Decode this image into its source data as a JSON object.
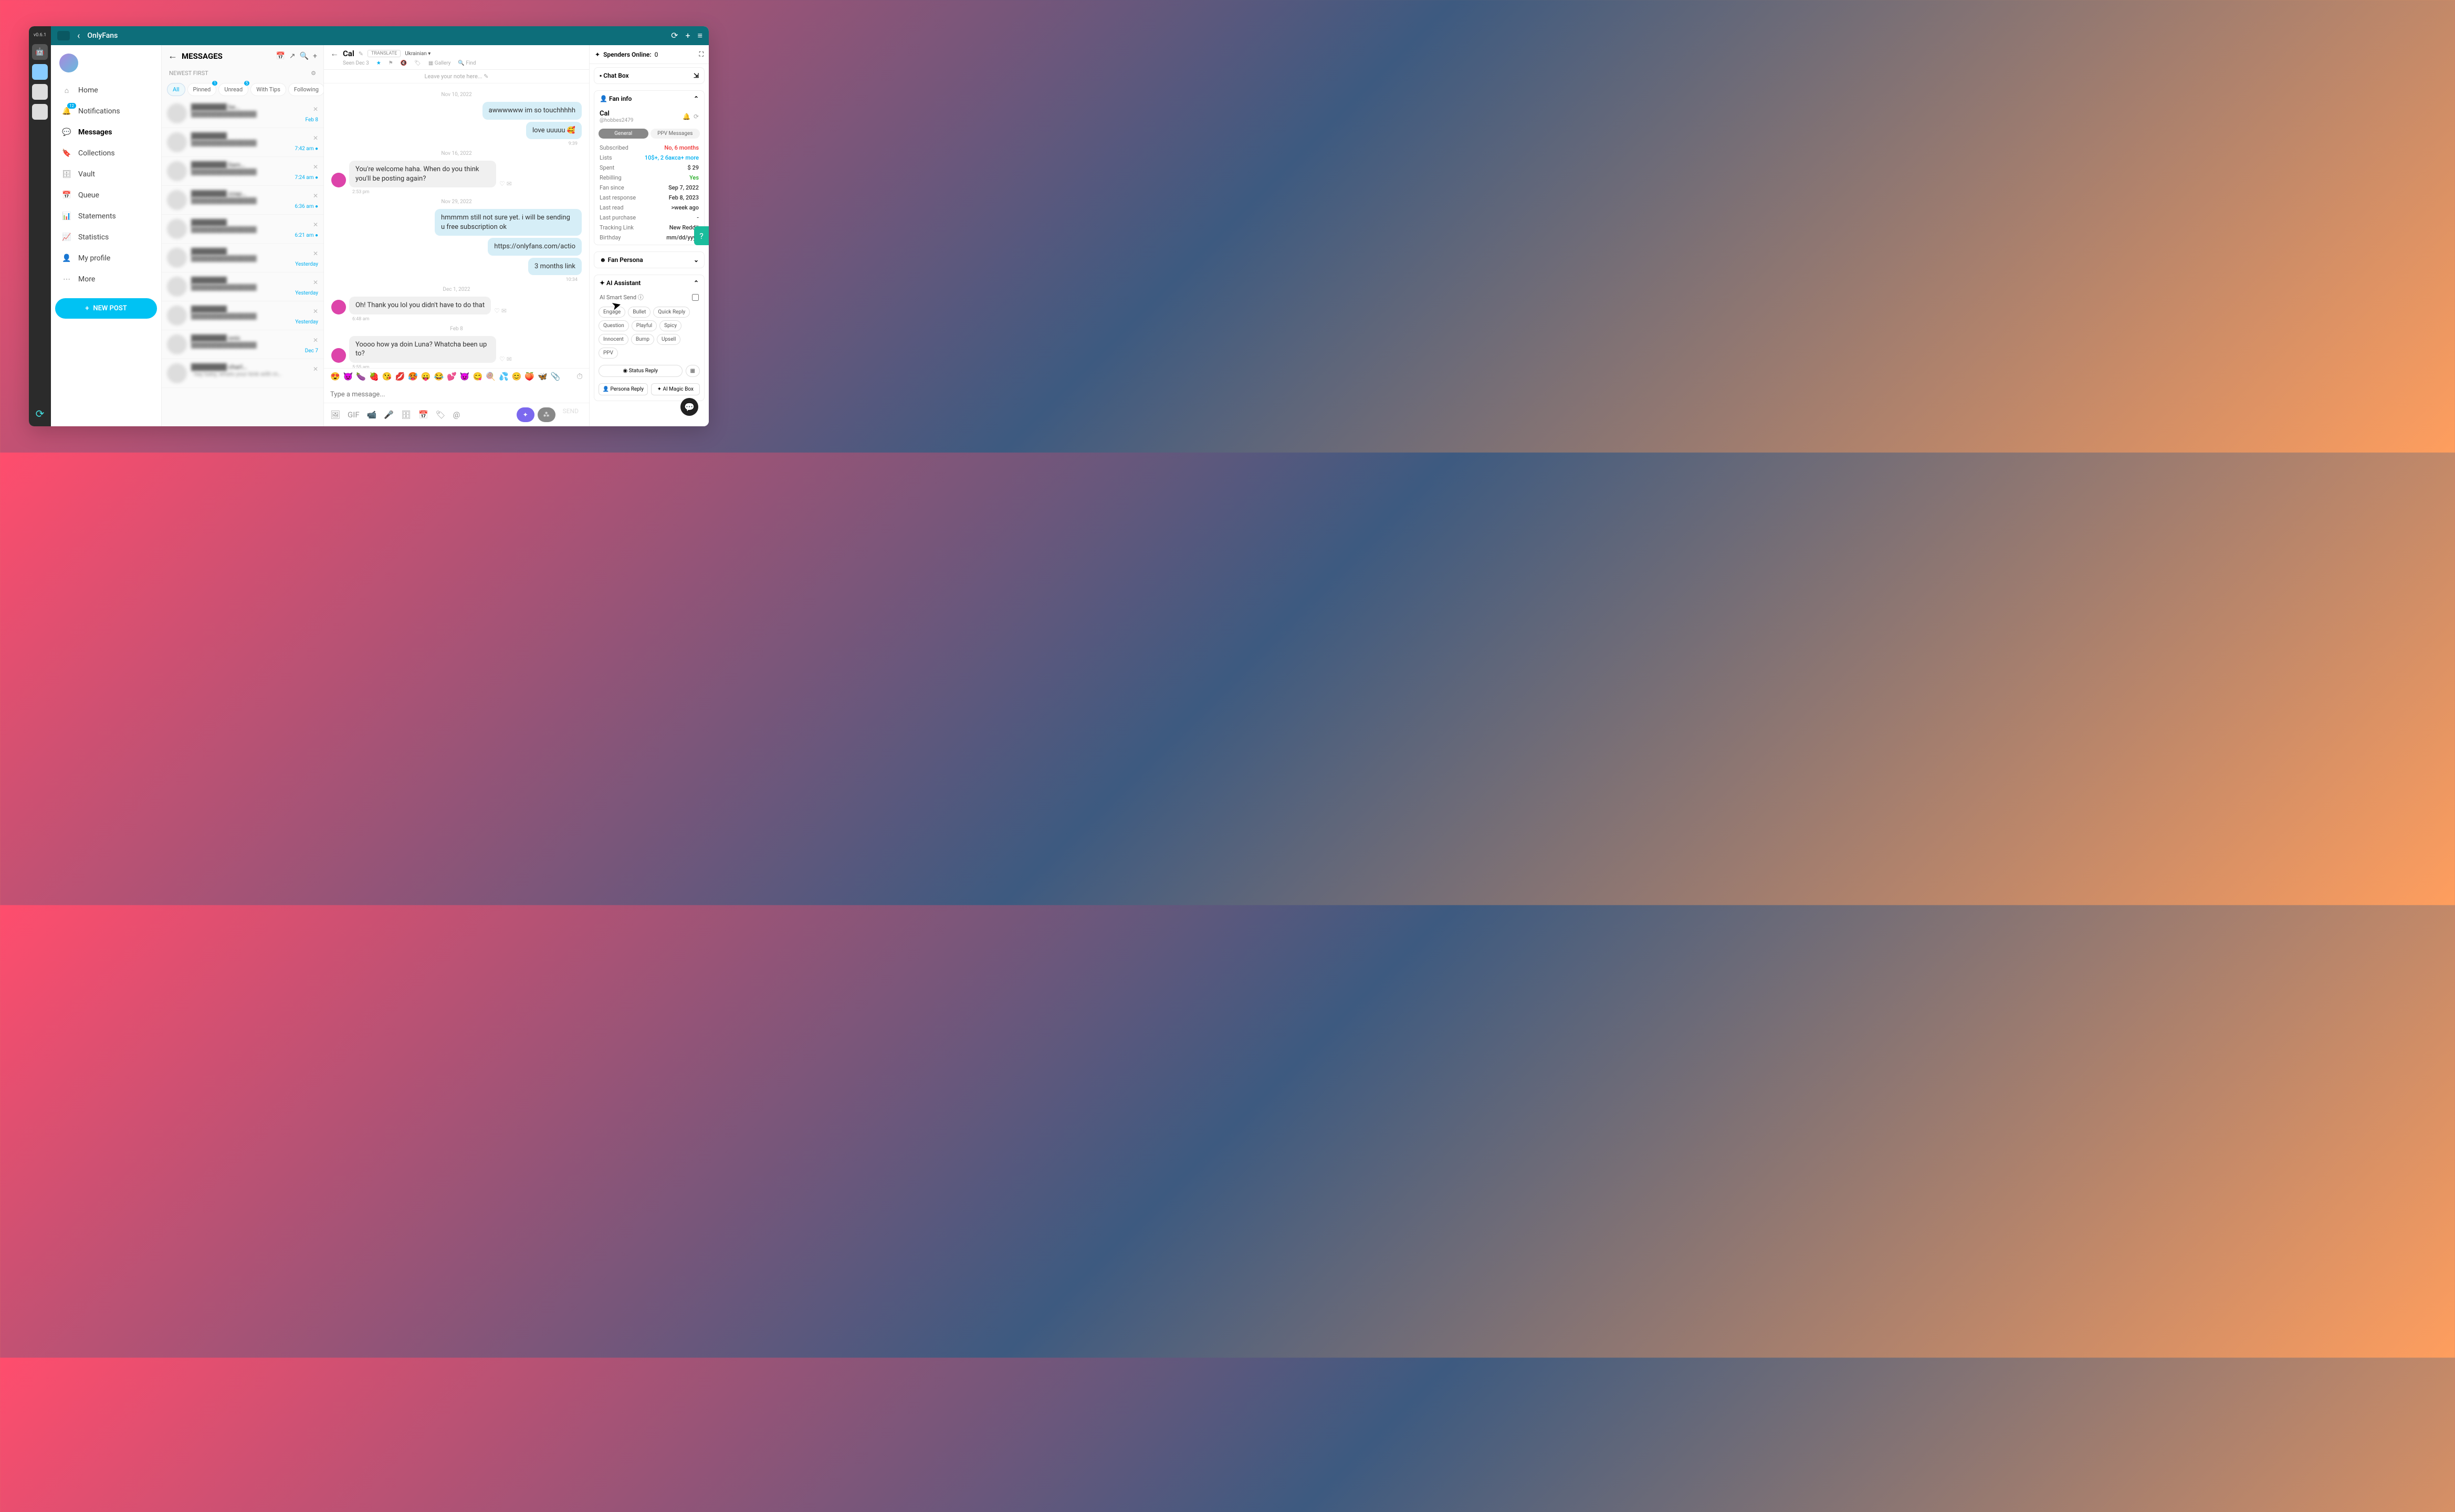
{
  "version": "v0.6.1",
  "titlebar": {
    "title": "OnlyFans"
  },
  "sidebar": {
    "items": [
      {
        "label": "Home",
        "icon": "home-icon"
      },
      {
        "label": "Notifications",
        "icon": "bell-icon",
        "badge": "12"
      },
      {
        "label": "Messages",
        "icon": "chat-icon",
        "active": true
      },
      {
        "label": "Collections",
        "icon": "bookmark-icon"
      },
      {
        "label": "Vault",
        "icon": "archive-icon"
      },
      {
        "label": "Queue",
        "icon": "calendar-icon"
      },
      {
        "label": "Statements",
        "icon": "chart-icon"
      },
      {
        "label": "Statistics",
        "icon": "stats-icon"
      },
      {
        "label": "My profile",
        "icon": "person-icon"
      },
      {
        "label": "More",
        "icon": "more-icon"
      }
    ],
    "new_post": "NEW POST"
  },
  "msg_list": {
    "title": "MESSAGES",
    "sort": "NEWEST FIRST",
    "filters": [
      {
        "label": "All",
        "active": true
      },
      {
        "label": "Pinned",
        "badge": "1"
      },
      {
        "label": "Unread",
        "badge": "5"
      },
      {
        "label": "With Tips"
      },
      {
        "label": "Following"
      }
    ],
    "conversations": [
      {
        "suffix": "be…",
        "time": "Feb 8"
      },
      {
        "suffix": "",
        "time": "7:42 am",
        "unread": true
      },
      {
        "suffix": "liam…",
        "time": "7:24 am",
        "unread": true
      },
      {
        "suffix": "zzap…",
        "time": "6:36 am",
        "unread": true
      },
      {
        "suffix": "",
        "time": "6:21 am",
        "unread": true
      },
      {
        "suffix": "",
        "time": "Yesterday"
      },
      {
        "suffix": "",
        "time": "Yesterday"
      },
      {
        "suffix": "",
        "time": "Yesterday"
      },
      {
        "suffix": "onic",
        "time": "Dec 7"
      },
      {
        "suffix": "charl…",
        "time": "",
        "preview": "· hey baby, whats your kink with m…"
      }
    ]
  },
  "chat": {
    "name": "Cal",
    "translate": "TRANSLATE",
    "language": "Ukrainian",
    "seen": "Seen Dec 3",
    "toolbar": {
      "gallery": "Gallery",
      "find": "Find"
    },
    "note_placeholder": "Leave your note here...",
    "thread": [
      {
        "type": "date",
        "text": "Nov 10, 2022"
      },
      {
        "type": "out",
        "text": "awwwwww im so touchhhhh"
      },
      {
        "type": "out",
        "text": "love uuuuu 🥰"
      },
      {
        "type": "time_right",
        "text": "9:39"
      },
      {
        "type": "date",
        "text": "Nov 16, 2022"
      },
      {
        "type": "in",
        "text": "You're welcome haha. When do you think you'll be posting again?",
        "avatar": true
      },
      {
        "type": "time",
        "text": "2:53 pm"
      },
      {
        "type": "date",
        "text": "Nov 29, 2022"
      },
      {
        "type": "out",
        "text": "hmmmm still not sure yet. i will be sending u free subscription ok"
      },
      {
        "type": "out_link",
        "text": "https://onlyfans.com/actio"
      },
      {
        "type": "out",
        "text": "3 months link"
      },
      {
        "type": "time_right",
        "text": "10:34"
      },
      {
        "type": "date",
        "text": "Dec 1, 2022"
      },
      {
        "type": "in",
        "text": "Oh! Thank you lol you didn't have to do that",
        "avatar": true
      },
      {
        "type": "time",
        "text": "6:48 am"
      },
      {
        "type": "date",
        "text": "Feb 8"
      },
      {
        "type": "in",
        "text": "Yoooo how ya doin Luna? Whatcha been up to?",
        "avatar": true
      },
      {
        "type": "time",
        "text": "5:55 am"
      }
    ],
    "emoji": [
      "😍",
      "😈",
      "🍆",
      "🍓",
      "😘",
      "💋",
      "🥵",
      "😛",
      "😂",
      "💕",
      "😈",
      "😋",
      "🍭",
      "💦",
      "😊",
      "🍑",
      "🦋"
    ],
    "input_placeholder": "Type a message...",
    "send_label": "SEND"
  },
  "right": {
    "spenders_label": "Spenders Online:",
    "spenders_count": "0",
    "chatbox": "Chat Box",
    "fan_info": "Fan info",
    "fan_name": "Cal",
    "fan_handle": "@hobbes2479",
    "tabs": {
      "general": "General",
      "ppv": "PPV Messages"
    },
    "info": [
      {
        "k": "Subscribed",
        "v": "No, 6 months",
        "cls": "red"
      },
      {
        "k": "Lists",
        "v": "10$+, 2 баксa+ more",
        "cls": "link"
      },
      {
        "k": "Spent",
        "v": "$ 29"
      },
      {
        "k": "Rebilling",
        "v": "Yes",
        "cls": "green"
      },
      {
        "k": "Fan since",
        "v": "Sep 7, 2022"
      },
      {
        "k": "Last response",
        "v": "Feb 8, 2023"
      },
      {
        "k": "Last read",
        "v": ">week ago"
      },
      {
        "k": "Last purchase",
        "v": "-"
      },
      {
        "k": "Tracking Link",
        "v": "New Reddit"
      },
      {
        "k": "Birthday",
        "v": "mm/dd/yyyy"
      }
    ],
    "fan_persona": "Fan Persona",
    "ai_assistant": "AI Assistant",
    "ai_smart_send": "AI Smart Send",
    "ai_buttons": [
      "Engage",
      "Bullet",
      "Quick Reply",
      "Question",
      "Playful",
      "Spicy",
      "Innocent",
      "Bump",
      "Upsell",
      "PPV"
    ],
    "status_reply": "Status Reply",
    "persona_reply": "Persona Reply",
    "magic_box": "AI Magic Box"
  }
}
